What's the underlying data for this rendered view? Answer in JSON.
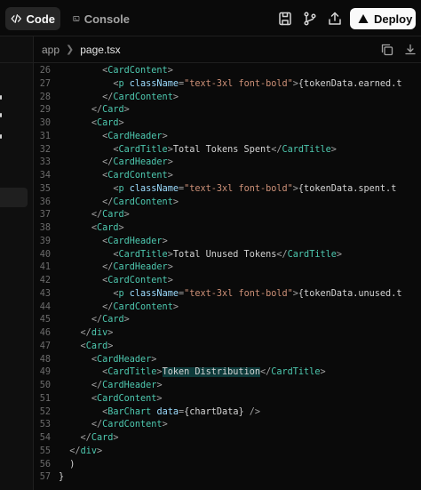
{
  "topbar": {
    "tabs": [
      {
        "label": "Code",
        "icon": "code-icon",
        "active": true
      },
      {
        "label": "Console",
        "icon": "terminal-icon",
        "active": false
      }
    ],
    "tools": [
      "save-icon",
      "branch-icon",
      "share-icon"
    ],
    "deploy_label": "Deploy",
    "deploy_icon": "triangle-icon"
  },
  "breadcrumb": {
    "folder": "app",
    "file": "page.tsx"
  },
  "editor_tools": [
    "copy-icon",
    "download-icon"
  ],
  "highlight_text": "Token Distribution",
  "code_lines": [
    {
      "n": "26",
      "indent": "        ",
      "parts": [
        [
          "pun",
          "<"
        ],
        [
          "tag",
          "CardContent"
        ],
        [
          "pun",
          ">"
        ]
      ]
    },
    {
      "n": "27",
      "indent": "          ",
      "parts": [
        [
          "pun",
          "<"
        ],
        [
          "tag",
          "p"
        ],
        [
          "plain",
          " "
        ],
        [
          "attr",
          "className"
        ],
        [
          "pun",
          "="
        ],
        [
          "str",
          "\"text-3xl font-bold\""
        ],
        [
          "pun",
          ">"
        ],
        [
          "plain",
          "{tokenData.earned.t"
        ]
      ]
    },
    {
      "n": "28",
      "indent": "        ",
      "parts": [
        [
          "pun",
          "</"
        ],
        [
          "tag",
          "CardContent"
        ],
        [
          "pun",
          ">"
        ]
      ]
    },
    {
      "n": "29",
      "indent": "      ",
      "parts": [
        [
          "pun",
          "</"
        ],
        [
          "tag",
          "Card"
        ],
        [
          "pun",
          ">"
        ]
      ]
    },
    {
      "n": "30",
      "indent": "      ",
      "parts": [
        [
          "pun",
          "<"
        ],
        [
          "tag",
          "Card"
        ],
        [
          "pun",
          ">"
        ]
      ]
    },
    {
      "n": "31",
      "indent": "        ",
      "parts": [
        [
          "pun",
          "<"
        ],
        [
          "tag",
          "CardHeader"
        ],
        [
          "pun",
          ">"
        ]
      ]
    },
    {
      "n": "32",
      "indent": "          ",
      "parts": [
        [
          "pun",
          "<"
        ],
        [
          "tag",
          "CardTitle"
        ],
        [
          "pun",
          ">"
        ],
        [
          "plain",
          "Total Tokens Spent"
        ],
        [
          "pun",
          "</"
        ],
        [
          "tag",
          "CardTitle"
        ],
        [
          "pun",
          ">"
        ]
      ]
    },
    {
      "n": "33",
      "indent": "        ",
      "parts": [
        [
          "pun",
          "</"
        ],
        [
          "tag",
          "CardHeader"
        ],
        [
          "pun",
          ">"
        ]
      ]
    },
    {
      "n": "34",
      "indent": "        ",
      "parts": [
        [
          "pun",
          "<"
        ],
        [
          "tag",
          "CardContent"
        ],
        [
          "pun",
          ">"
        ]
      ]
    },
    {
      "n": "35",
      "indent": "          ",
      "parts": [
        [
          "pun",
          "<"
        ],
        [
          "tag",
          "p"
        ],
        [
          "plain",
          " "
        ],
        [
          "attr",
          "className"
        ],
        [
          "pun",
          "="
        ],
        [
          "str",
          "\"text-3xl font-bold\""
        ],
        [
          "pun",
          ">"
        ],
        [
          "plain",
          "{tokenData.spent.t"
        ]
      ]
    },
    {
      "n": "36",
      "indent": "        ",
      "parts": [
        [
          "pun",
          "</"
        ],
        [
          "tag",
          "CardContent"
        ],
        [
          "pun",
          ">"
        ]
      ]
    },
    {
      "n": "37",
      "indent": "      ",
      "parts": [
        [
          "pun",
          "</"
        ],
        [
          "tag",
          "Card"
        ],
        [
          "pun",
          ">"
        ]
      ]
    },
    {
      "n": "38",
      "indent": "      ",
      "parts": [
        [
          "pun",
          "<"
        ],
        [
          "tag",
          "Card"
        ],
        [
          "pun",
          ">"
        ]
      ]
    },
    {
      "n": "39",
      "indent": "        ",
      "parts": [
        [
          "pun",
          "<"
        ],
        [
          "tag",
          "CardHeader"
        ],
        [
          "pun",
          ">"
        ]
      ]
    },
    {
      "n": "40",
      "indent": "          ",
      "parts": [
        [
          "pun",
          "<"
        ],
        [
          "tag",
          "CardTitle"
        ],
        [
          "pun",
          ">"
        ],
        [
          "plain",
          "Total Unused Tokens"
        ],
        [
          "pun",
          "</"
        ],
        [
          "tag",
          "CardTitle"
        ],
        [
          "pun",
          ">"
        ]
      ]
    },
    {
      "n": "41",
      "indent": "        ",
      "parts": [
        [
          "pun",
          "</"
        ],
        [
          "tag",
          "CardHeader"
        ],
        [
          "pun",
          ">"
        ]
      ]
    },
    {
      "n": "42",
      "indent": "        ",
      "parts": [
        [
          "pun",
          "<"
        ],
        [
          "tag",
          "CardContent"
        ],
        [
          "pun",
          ">"
        ]
      ]
    },
    {
      "n": "43",
      "indent": "          ",
      "parts": [
        [
          "pun",
          "<"
        ],
        [
          "tag",
          "p"
        ],
        [
          "plain",
          " "
        ],
        [
          "attr",
          "className"
        ],
        [
          "pun",
          "="
        ],
        [
          "str",
          "\"text-3xl font-bold\""
        ],
        [
          "pun",
          ">"
        ],
        [
          "plain",
          "{tokenData.unused.t"
        ]
      ]
    },
    {
      "n": "44",
      "indent": "        ",
      "parts": [
        [
          "pun",
          "</"
        ],
        [
          "tag",
          "CardContent"
        ],
        [
          "pun",
          ">"
        ]
      ]
    },
    {
      "n": "45",
      "indent": "      ",
      "parts": [
        [
          "pun",
          "</"
        ],
        [
          "tag",
          "Card"
        ],
        [
          "pun",
          ">"
        ]
      ]
    },
    {
      "n": "46",
      "indent": "    ",
      "parts": [
        [
          "pun",
          "</"
        ],
        [
          "tag",
          "div"
        ],
        [
          "pun",
          ">"
        ]
      ]
    },
    {
      "n": "47",
      "indent": "    ",
      "parts": [
        [
          "pun",
          "<"
        ],
        [
          "tag",
          "Card"
        ],
        [
          "pun",
          ">"
        ]
      ]
    },
    {
      "n": "48",
      "indent": "      ",
      "parts": [
        [
          "pun",
          "<"
        ],
        [
          "tag",
          "CardHeader"
        ],
        [
          "pun",
          ">"
        ]
      ]
    },
    {
      "n": "49",
      "indent": "        ",
      "parts": [
        [
          "pun",
          "<"
        ],
        [
          "tag",
          "CardTitle"
        ],
        [
          "pun",
          ">"
        ],
        [
          "hl",
          "Token Distribution"
        ],
        [
          "pun",
          "</"
        ],
        [
          "tag",
          "CardTitle"
        ],
        [
          "pun",
          ">"
        ]
      ]
    },
    {
      "n": "50",
      "indent": "      ",
      "parts": [
        [
          "pun",
          "</"
        ],
        [
          "tag",
          "CardHeader"
        ],
        [
          "pun",
          ">"
        ]
      ]
    },
    {
      "n": "51",
      "indent": "      ",
      "parts": [
        [
          "pun",
          "<"
        ],
        [
          "tag",
          "CardContent"
        ],
        [
          "pun",
          ">"
        ]
      ]
    },
    {
      "n": "52",
      "indent": "        ",
      "parts": [
        [
          "pun",
          "<"
        ],
        [
          "tag",
          "BarChart"
        ],
        [
          "plain",
          " "
        ],
        [
          "attr",
          "data"
        ],
        [
          "pun",
          "="
        ],
        [
          "plain",
          "{chartData} "
        ],
        [
          "pun",
          "/>"
        ]
      ]
    },
    {
      "n": "53",
      "indent": "      ",
      "parts": [
        [
          "pun",
          "</"
        ],
        [
          "tag",
          "CardContent"
        ],
        [
          "pun",
          ">"
        ]
      ]
    },
    {
      "n": "54",
      "indent": "    ",
      "parts": [
        [
          "pun",
          "</"
        ],
        [
          "tag",
          "Card"
        ],
        [
          "pun",
          ">"
        ]
      ]
    },
    {
      "n": "55",
      "indent": "  ",
      "parts": [
        [
          "pun",
          "</"
        ],
        [
          "tag",
          "div"
        ],
        [
          "pun",
          ">"
        ]
      ]
    },
    {
      "n": "56",
      "indent": "  ",
      "parts": [
        [
          "plain",
          ")"
        ]
      ]
    },
    {
      "n": "57",
      "indent": "",
      "parts": [
        [
          "plain",
          "}"
        ]
      ]
    }
  ]
}
